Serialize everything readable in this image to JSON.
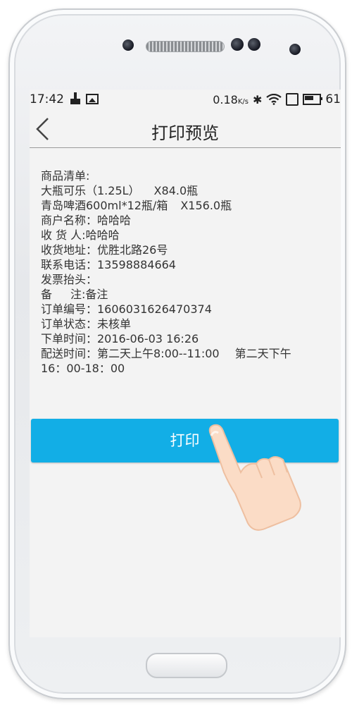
{
  "status": {
    "time": "17:42",
    "net_speed": "0.18",
    "net_unit": "K/s",
    "battery": "61"
  },
  "header": {
    "title": "打印预览"
  },
  "order": {
    "goods_label": "商品清单:",
    "items": [
      {
        "name": "大瓶可乐（1.25L）",
        "qty": "X84.0瓶"
      },
      {
        "name": "青岛啤酒600ml*12瓶/箱",
        "qty": "X156.0瓶"
      }
    ],
    "merchant": "商户名称：哈哈哈",
    "receiver": "收 货 人:哈哈哈",
    "address": "收货地址：优胜北路26号",
    "phone": "联系电话：13598884664",
    "invoice": "发票抬头：",
    "remark_label": "备",
    "remark_value": "注:备注",
    "order_no": "订单编号：1606031626470374",
    "state": "订单状态：未核单",
    "order_time": "下单时间：2016-06-03 16:26",
    "delivery_1": "配送时间：第二天上午8:00--11:00",
    "delivery_2": "第二天下午",
    "delivery_3": "16：00-18：00"
  },
  "actions": {
    "print_label": "打印"
  },
  "colors": {
    "accent": "#12aee6",
    "screen_bg": "#f3f3f3"
  },
  "icons": [
    "broom-icon",
    "image-icon",
    "bluetooth-icon",
    "wifi-icon",
    "no-sim-icon",
    "battery-icon",
    "back-arrow-icon",
    "hand-pointer-icon"
  ]
}
